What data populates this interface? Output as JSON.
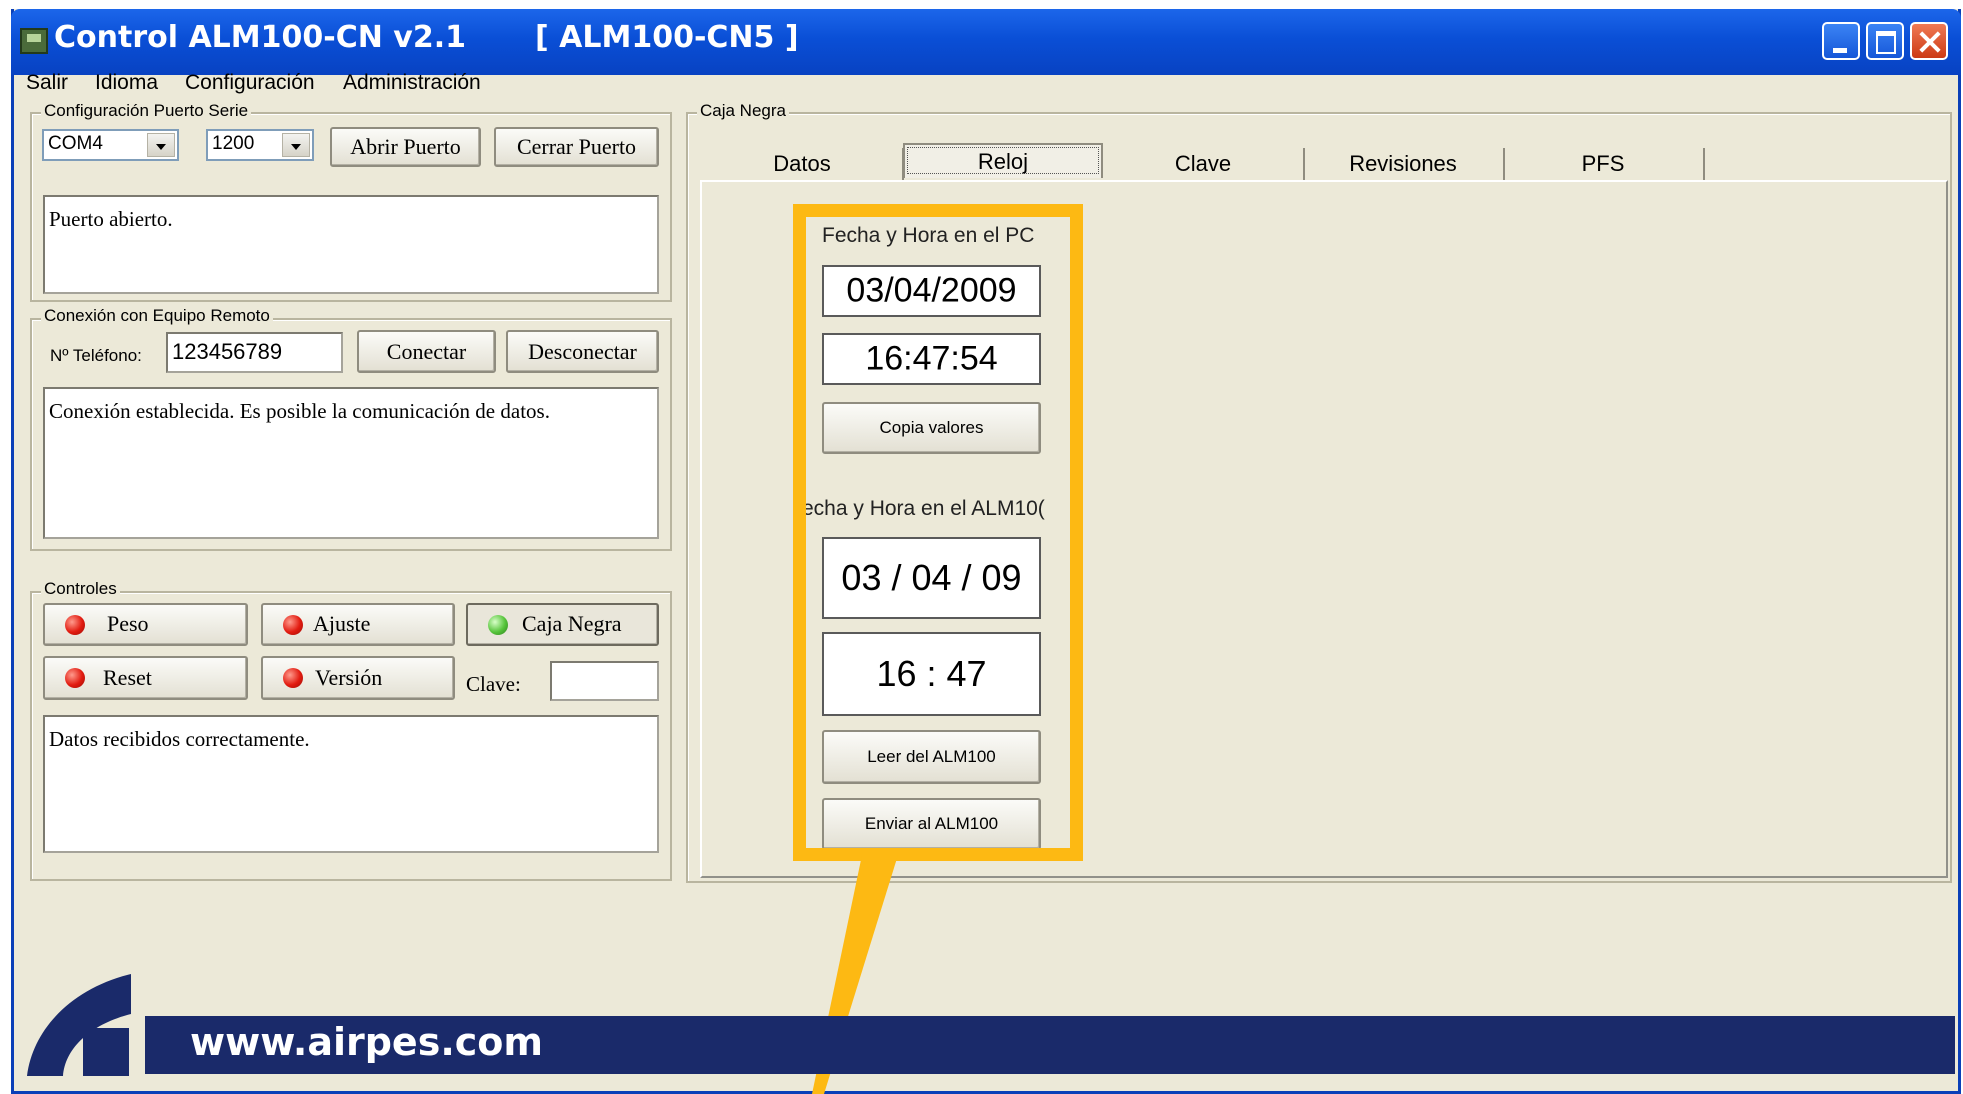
{
  "window": {
    "title": "Control ALM100-CN v2.1",
    "device_tag": "[ ALM100-CN5 ]",
    "title_bar_color": "#0a4fd6"
  },
  "menu": [
    "Salir",
    "Idioma",
    "Configuración",
    "Administración"
  ],
  "serial_port": {
    "group_label": "Configuración Puerto Serie",
    "port_value": "COM4",
    "baud_value": "1200",
    "open_label": "Abrir Puerto",
    "close_label": "Cerrar Puerto",
    "status_text": "Puerto abierto."
  },
  "remote": {
    "group_label": "Conexión con Equipo Remoto",
    "phone_label": "Nº Teléfono:",
    "phone_value": "123456789",
    "connect_label": "Conectar",
    "disconnect_label": "Desconectar",
    "status_text": "Conexión establecida. Es posible la comunicación de datos."
  },
  "controls": {
    "group_label": "Controles",
    "buttons": [
      {
        "label": "Peso",
        "led": "red"
      },
      {
        "label": "Ajuste",
        "led": "red"
      },
      {
        "label": "Caja Negra",
        "led": "green"
      },
      {
        "label": "Reset",
        "led": "red"
      },
      {
        "label": "Versión",
        "led": "red"
      }
    ],
    "key_label": "Clave:",
    "key_value": "",
    "status_text": "Datos recibidos correctamente."
  },
  "black_box": {
    "group_label": "Caja Negra",
    "tabs": [
      "Datos",
      "Reloj",
      "Clave",
      "Revisiones",
      "PFS"
    ],
    "active_tab": "Reloj",
    "clock": {
      "pc_label": "Fecha y Hora en el PC",
      "pc_date": "03/04/2009",
      "pc_time": "16:47:54",
      "copy_label": "Copia valores",
      "alm_label": "echa y Hora en el ALM10(",
      "alm_date": "03 / 04 / 09",
      "alm_time": "16  :  47",
      "read_label": "Leer del ALM100",
      "send_label": "Enviar al ALM100"
    },
    "highlight_color": "#fdb913"
  },
  "footer": {
    "url": "www.airpes.com",
    "bar_color": "#1a2a6a"
  },
  "icons": [
    "app-icon",
    "minimize-icon",
    "maximize-icon",
    "close-icon",
    "chevron-down-icon",
    "status-led-icon",
    "airpes-logo-icon"
  ]
}
